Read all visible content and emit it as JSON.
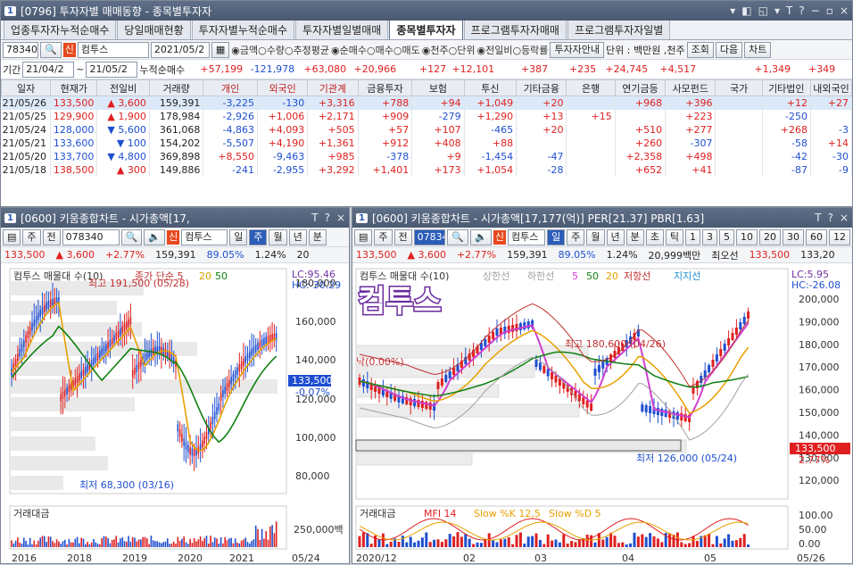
{
  "top": {
    "num": "1",
    "title": "[0796] 투자자별 매매동향 - 종목별투자자",
    "controls": [
      "▾",
      "◧",
      "◱",
      "▾",
      "T",
      "?",
      "−",
      "▫",
      "×"
    ],
    "tabs": [
      "업종투자자누적순매수",
      "당일매매현황",
      "투자자별누적순매수",
      "투자자별일별매매",
      "종목별투자자",
      "프로그램투자자매매",
      "프로그램투자자일별"
    ],
    "active_tab": 4,
    "code": "78340",
    "name_chip": "신",
    "name": "컴투스",
    "date": "2021/05/2",
    "radios1": [
      "금액",
      "수량",
      "추정평균"
    ],
    "radios2": [
      "순매수",
      "매수",
      "매도"
    ],
    "radios3": [
      "천주",
      "단위"
    ],
    "radios4": [
      "전일비",
      "등락률"
    ],
    "btn_info": "투자자안내",
    "unit": "단위 : 백만원 ,천주",
    "btn_query": "조회",
    "btn_next": "다음",
    "btn_chart": "차트",
    "period_label": "기간",
    "from": "21/04/2",
    "to": "21/05/2",
    "cum_label": "누적순매수",
    "cum": [
      "+57,199",
      "-121,978",
      "+63,080",
      "+20,966",
      "+127",
      "+12,101",
      "+387",
      "+235",
      "+24,745",
      "+4,517",
      "",
      "+1,349",
      "+349"
    ],
    "headers": [
      "일자",
      "현재가",
      "전일비",
      "거래량",
      "개인",
      "외국인",
      "기관계",
      "금융투자",
      "보험",
      "투신",
      "기타금융",
      "은행",
      "연기금등",
      "사모펀드",
      "국가",
      "기타법인",
      "내외국인"
    ],
    "rows": [
      [
        "21/05/26",
        "133,500",
        "▲",
        "3,600",
        "159,391",
        "-3,225",
        "-130",
        "+3,316",
        "+788",
        "+94",
        "+1,049",
        "+20",
        "",
        "+968",
        "+396",
        "",
        "+12",
        "+27"
      ],
      [
        "21/05/25",
        "129,900",
        "▲",
        "1,900",
        "178,984",
        "-2,926",
        "+1,006",
        "+2,171",
        "+909",
        "-279",
        "+1,290",
        "+13",
        "+15",
        "",
        "+223",
        "",
        "-250",
        ""
      ],
      [
        "21/05/24",
        "128,000",
        "▼",
        "5,600",
        "361,068",
        "-4,863",
        "+4,093",
        "+505",
        "+57",
        "+107",
        "-465",
        "+20",
        "",
        "+510",
        "+277",
        "",
        "+268",
        "-3"
      ],
      [
        "21/05/21",
        "133,600",
        "▼",
        "100",
        "154,202",
        "-5,507",
        "+4,190",
        "+1,361",
        "+912",
        "+408",
        "+88",
        "",
        "",
        "+260",
        "-307",
        "",
        "-58",
        "+14"
      ],
      [
        "21/05/20",
        "133,700",
        "▼",
        "4,800",
        "369,898",
        "+8,550",
        "-9,463",
        "+985",
        "-378",
        "+9",
        "-1,454",
        "-47",
        "",
        "+2,358",
        "+498",
        "",
        "-42",
        "-30"
      ],
      [
        "21/05/18",
        "138,500",
        "▲",
        "300",
        "149,886",
        "-241",
        "-2,955",
        "+3,292",
        "+1,401",
        "+173",
        "+1,054",
        "-28",
        "",
        "+652",
        "+41",
        "",
        "-87",
        "-9"
      ]
    ]
  },
  "left": {
    "num": "1",
    "title": "[0600] 키움종합차트 - 시가총액[17,",
    "code": "078340",
    "chip": "신",
    "name": "컴투스",
    "btns": [
      "일",
      "주",
      "월",
      "년",
      "분"
    ],
    "active": "주",
    "price": "133,500",
    "chg_arrow": "▲",
    "chg": "3,600",
    "pct": "+2.77%",
    "vol": "159,391",
    "r1": "89.05%",
    "r2": "1.24%",
    "r3": "20",
    "legend": [
      "컴투스 매물대 수(10)",
      "종가 단순 5",
      "20",
      "50"
    ],
    "lc": "LC:95.46",
    "hc": "HC:-30.29",
    "yticks": [
      "180,000",
      "160,000",
      "140,000",
      "120,000",
      "100,000",
      "80,000"
    ],
    "cur": "133,500",
    "cur_pct": "-0.07%",
    "high": "최고 191,500 (05/28)",
    "low": "최저 68,300 (03/16)",
    "vol_label": "거래대금",
    "vol_tick": "250,000백",
    "xticks": [
      "2016",
      "2018",
      "2019",
      "2020",
      "2021",
      "05/24"
    ]
  },
  "right": {
    "num": "1",
    "title": "[0600] 키움종합차트 - 시가총액[17,177(억)] PER[21.37] PBR[1.63]",
    "code": "078340",
    "chip": "신",
    "name": "컴투스",
    "btns": [
      "일",
      "주",
      "월",
      "년",
      "분",
      "초",
      "틱"
    ],
    "nums": [
      "1",
      "3",
      "5",
      "10",
      "20",
      "30",
      "60",
      "12"
    ],
    "active": "일",
    "price": "133,500",
    "chg_arrow": "▲",
    "chg": "3,600",
    "pct": "+2.77%",
    "vol": "159,391",
    "r1": "89.05%",
    "r2": "1.24%",
    "cap": "20,999백만",
    "holder": "최오선",
    "p2": "133,500",
    "p3": "133,20",
    "legend": [
      "컴투스 매물대 수(10)",
      "상한선",
      "하한선",
      "5",
      "50",
      "20",
      "저항선",
      "지지선"
    ],
    "lc": "LC:5.95",
    "hc": "HC:-26.08",
    "yticks": [
      "200,000",
      "190,000",
      "180,000",
      "170,000",
      "160,000",
      "150,000",
      "140,000",
      "130,000",
      "120,000"
    ],
    "cur": "133,500",
    "cur_pct": "2.77%",
    "big": "컴투스",
    "high": "최고 180,600 (04/26)",
    "low": "최저 126,000 (05/24)",
    "lock": "낙(0.00%)",
    "ind_legend": [
      "거래대금",
      "MFI 14",
      "Slow %K 12,5",
      "Slow %D 5"
    ],
    "ind_ticks": [
      "100.00",
      "50.00",
      "0.00"
    ],
    "xticks": [
      "2020/12",
      "02",
      "03",
      "04",
      "05",
      "05/26"
    ]
  }
}
